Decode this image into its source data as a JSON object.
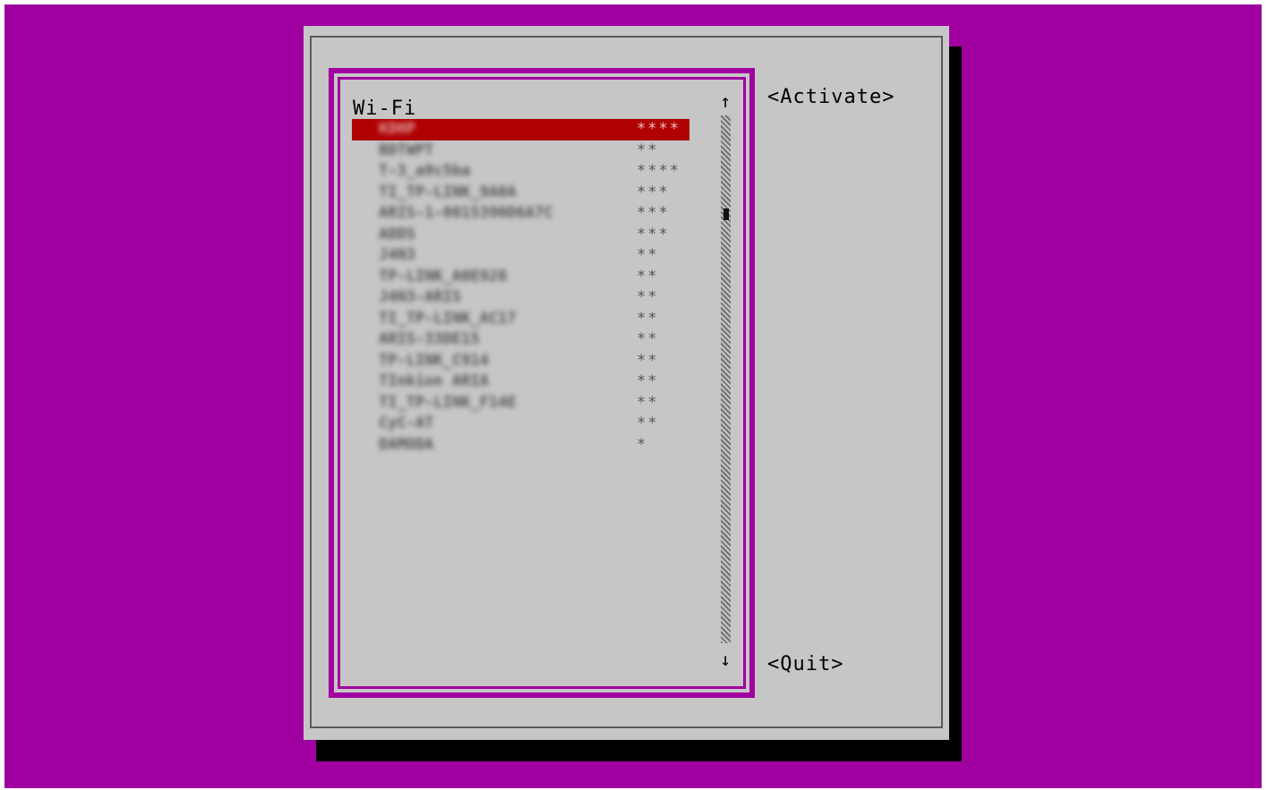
{
  "list": {
    "section_title": "Wi-Fi",
    "networks": [
      {
        "ssid": "KDHP",
        "signal": "****",
        "selected": true
      },
      {
        "ssid": "BDTWPT",
        "signal": "**"
      },
      {
        "ssid": "T-3_a9c5ba",
        "signal": "****"
      },
      {
        "ssid": "TI_TP-LINK_9A0A",
        "signal": "***"
      },
      {
        "ssid": "ARIS-1-0015390D6A7C",
        "signal": "***"
      },
      {
        "ssid": "ADDS",
        "signal": "***"
      },
      {
        "ssid": "J4N3",
        "signal": "**"
      },
      {
        "ssid": "TP-LINK_A0E928",
        "signal": "**"
      },
      {
        "ssid": "J4N3-ARIS",
        "signal": "**"
      },
      {
        "ssid": "TI_TP-LINK_AC17",
        "signal": "**"
      },
      {
        "ssid": "ARIS-33DE15",
        "signal": "**"
      },
      {
        "ssid": "TP-LINK_C914",
        "signal": "**"
      },
      {
        "ssid": "TInkion ARIA",
        "signal": "**"
      },
      {
        "ssid": "TI_TP-LINK_F14E",
        "signal": "**"
      },
      {
        "ssid": "CyC-AT",
        "signal": "**"
      },
      {
        "ssid": "DAMODA",
        "signal": "*"
      }
    ]
  },
  "scrollbar": {
    "up_arrow": "↑",
    "down_arrow": "↓"
  },
  "buttons": {
    "activate": "<Activate>",
    "quit": "<Quit>"
  },
  "colors": {
    "background": "#a0009f",
    "dialog": "#c6c6c6",
    "selection": "#b00000"
  }
}
